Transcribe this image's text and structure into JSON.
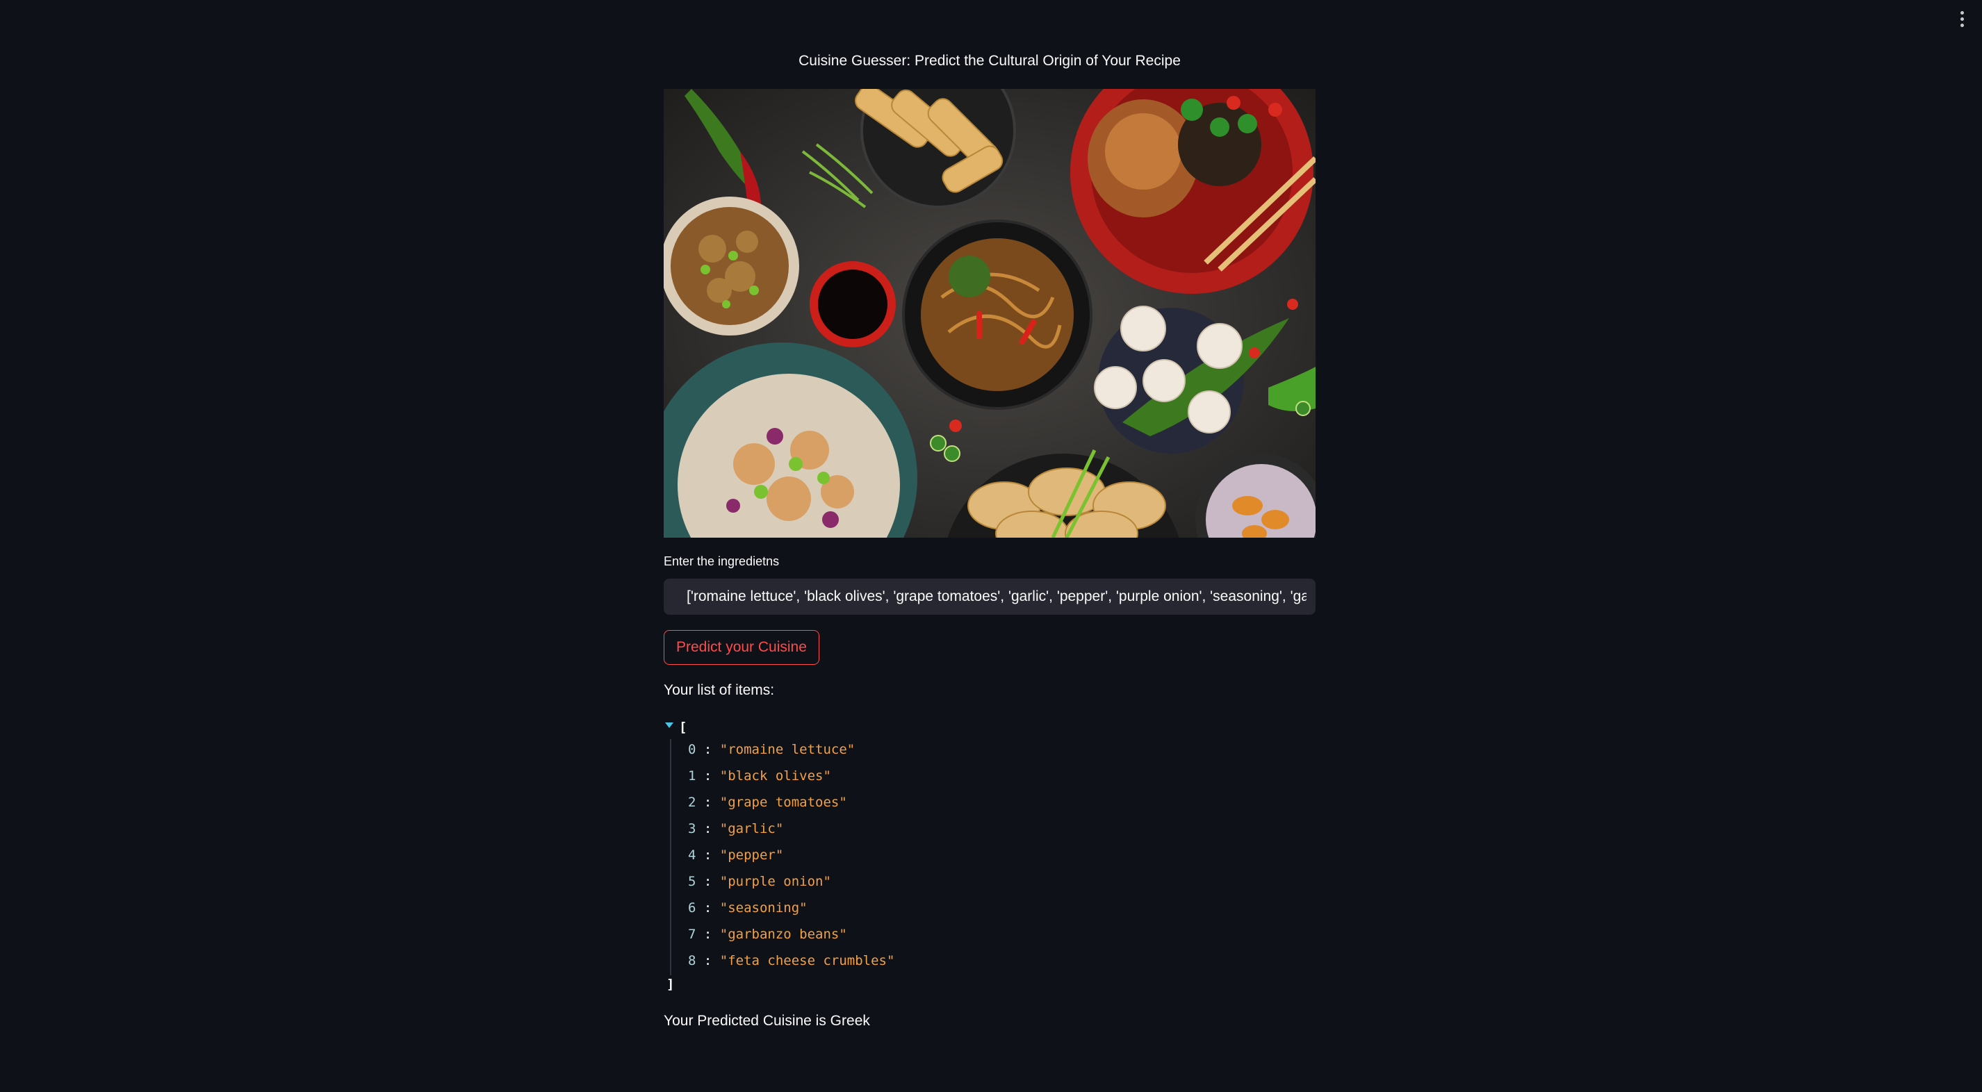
{
  "app": {
    "title": "Cuisine Guesser: Predict the Cultural Origin of Your Recipe",
    "menu_icon": "more-vertical-icon"
  },
  "hero_image": {
    "description": "asian-food-spread-photo"
  },
  "ingredients_input": {
    "label": "Enter the ingredietns",
    "value": "['romaine lettuce', 'black olives', 'grape tomatoes', 'garlic', 'pepper', 'purple onion', 'seasoning', 'garbanzo beans', 'feta cheese crumbles']"
  },
  "predict_button": {
    "label": "Predict your Cuisine",
    "color": "#ff4b4b"
  },
  "items_list": {
    "heading": "Your list of items:",
    "open_bracket": "[",
    "close_bracket": "]",
    "items": [
      {
        "index": "0",
        "value": "\"romaine lettuce\""
      },
      {
        "index": "1",
        "value": "\"black olives\""
      },
      {
        "index": "2",
        "value": "\"grape tomatoes\""
      },
      {
        "index": "3",
        "value": "\"garlic\""
      },
      {
        "index": "4",
        "value": "\"pepper\""
      },
      {
        "index": "5",
        "value": "\"purple onion\""
      },
      {
        "index": "6",
        "value": "\"seasoning\""
      },
      {
        "index": "7",
        "value": "\"garbanzo beans\""
      },
      {
        "index": "8",
        "value": "\"feta cheese crumbles\""
      }
    ]
  },
  "result": {
    "text": "Your Predicted Cuisine is Greek"
  },
  "colors": {
    "background": "#0e1117",
    "input_bg": "#262730",
    "accent": "#ff4b4b",
    "json_string": "#f2a144",
    "json_index": "#b0d4d9",
    "json_toggle": "#4ac6e8"
  }
}
